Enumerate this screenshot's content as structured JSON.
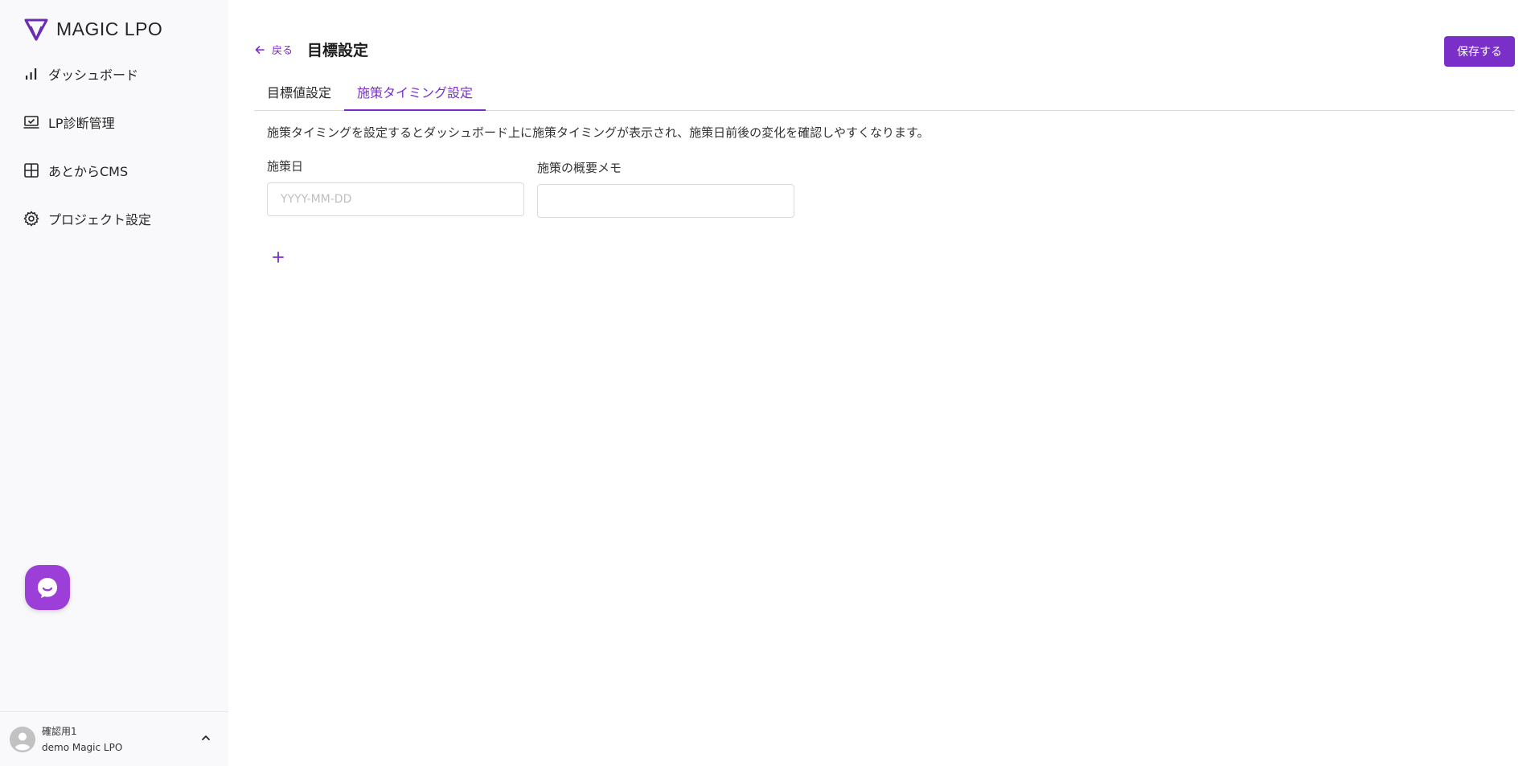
{
  "app": {
    "logo_text": "MAGIC LPO",
    "brand_color": "#7b2fc9"
  },
  "sidebar": {
    "items": [
      {
        "label": "ダッシュボード",
        "icon": "bar-chart-icon"
      },
      {
        "label": "LP診断管理",
        "icon": "laptop-check-icon"
      },
      {
        "label": "あとからCMS",
        "icon": "grid-icon"
      },
      {
        "label": "プロジェクト設定",
        "icon": "gear-icon"
      }
    ]
  },
  "user": {
    "name": "確認用1",
    "org": "demo Magic LPO"
  },
  "header": {
    "back_label": "戻る",
    "title": "目標設定",
    "save_label": "保存する"
  },
  "tabs": [
    {
      "label": "目標値設定",
      "active": false
    },
    {
      "label": "施策タイミング設定",
      "active": true
    }
  ],
  "content": {
    "description": "施策タイミングを設定するとダッシュボード上に施策タイミングが表示され、施策日前後の変化を確認しやすくなります。",
    "date_label": "施策日",
    "date_placeholder": "YYYY-MM-DD",
    "date_value": "",
    "memo_label": "施策の概要メモ",
    "memo_value": ""
  }
}
